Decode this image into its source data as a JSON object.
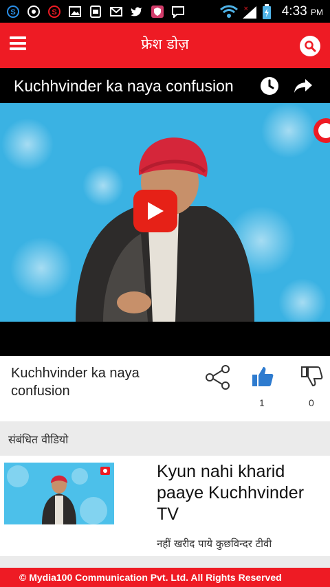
{
  "status_bar": {
    "time": "4:33",
    "ampm": "PM",
    "icons": [
      "skype-icon",
      "whatsapp-icon",
      "app-icon",
      "image-icon",
      "sim-icon",
      "email-icon",
      "twitter-icon",
      "shield-icon",
      "message-icon",
      "wifi-icon",
      "signal-icon",
      "battery-icon"
    ]
  },
  "app_bar": {
    "title": "फ्रेश डोज़"
  },
  "video": {
    "title": "Kuchhvinder ka naya confusion",
    "title_card": "Kuchhvinder ka naya confusion",
    "likes": "1",
    "dislikes": "0"
  },
  "related": {
    "heading": "संबंधित वीडियो",
    "items": [
      {
        "title": "Kyun nahi kharid paaye Kuchhvinder TV",
        "subtitle": "नहीं खरीद पाये कुछविन्दर टीवी"
      }
    ]
  },
  "footer": {
    "text": "© Mydia100 Communication Pvt. Ltd. All Rights Reserved"
  },
  "colors": {
    "brand_red": "#ee1b24",
    "youtube_red": "#e62117",
    "like_blue": "#2e7bcf"
  }
}
